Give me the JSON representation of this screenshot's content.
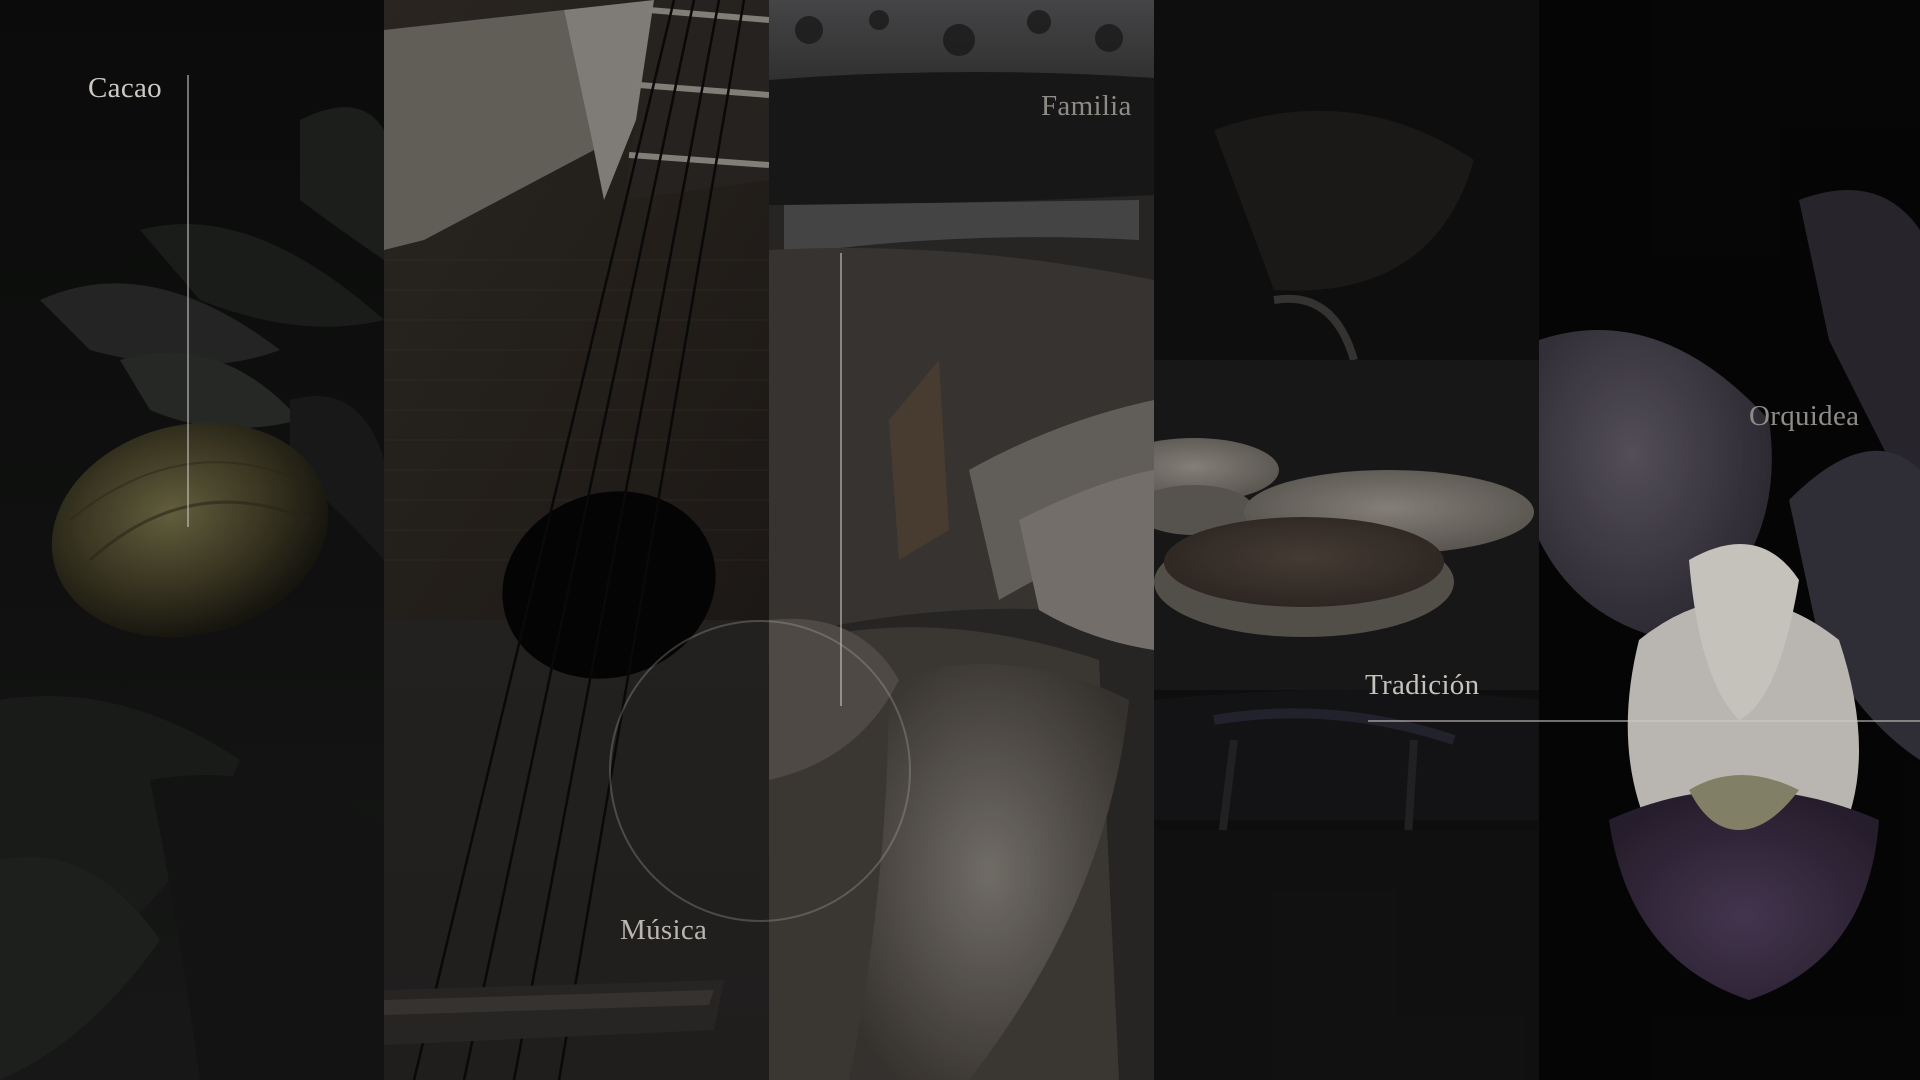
{
  "panels": [
    {
      "id": "cacao",
      "label": "Cacao"
    },
    {
      "id": "musica",
      "label": "Música"
    },
    {
      "id": "familia",
      "label": "Familia"
    },
    {
      "id": "tradicion",
      "label": "Tradición"
    },
    {
      "id": "orquidea",
      "label": "Orquidea"
    }
  ],
  "colors": {
    "background": "#000000",
    "label": "#c9c5c0",
    "rule": "#cdc8c3"
  },
  "icons": {
    "cacao": "cacao-pod-photo",
    "musica": "guitar-photo",
    "familia": "firewood-photo",
    "tradicion": "arepas-photo",
    "orquidea": "orchid-photo"
  }
}
